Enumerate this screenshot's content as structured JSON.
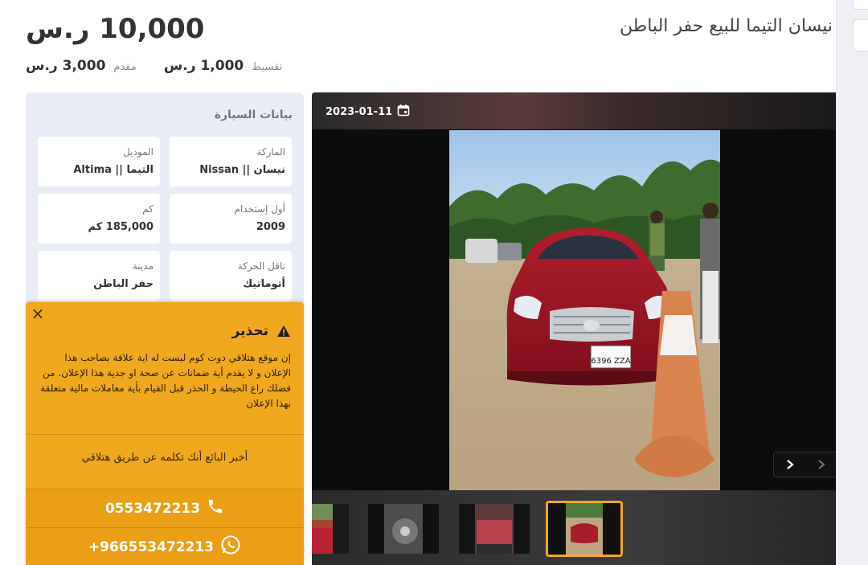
{
  "listing": {
    "title": "نيسان التيما للبيع حفر الباطن",
    "price": "10,000 ر.س"
  },
  "payments": {
    "installment_label": "تقسيط",
    "installment_value": "1,000 ر.س",
    "downpayment_label": "مقدم",
    "downpayment_value": "3,000 ر.س"
  },
  "details": {
    "title": "بيانات السيارة",
    "fields": [
      {
        "label": "الماركة",
        "value": "نيسان || Nissan"
      },
      {
        "label": "الموديل",
        "value": "التيما || Altima"
      },
      {
        "label": "أول إستخدام",
        "value": "2009"
      },
      {
        "label": "كم",
        "value": "185,000 كم"
      },
      {
        "label": "ناقل الحركة",
        "value": "أتوماتيك"
      },
      {
        "label": "مدينة",
        "value": "حفر الباطن"
      }
    ]
  },
  "warning": {
    "title": "تحذير",
    "body": "إن موقع هتلاقي دوت كوم ليست له اية علاقة بصاحب هذا الإعلان و لا يقدم أية ضمانات عن صحة او جدية هذا الإعلان. من فضلك راع الحيطة و الحذر قبل القيام بأية معاملات مالية متعلقة بهذا الإعلان",
    "hint": "أخبر البائع أنك تكلمه عن طريق هتلاقي",
    "phone": "0553472213",
    "whatsapp": "+966553472213",
    "close_icon": "close-icon",
    "icon": "warning-triangle-icon"
  },
  "gallery": {
    "date": "2023-01-11",
    "date_icon": "calendar-icon",
    "plate_text": "6396 ZZA",
    "thumbnail_count": 4,
    "active_thumbnail": 4
  },
  "colors": {
    "accent": "#f0a81e",
    "accent_dark": "#ea9f17",
    "card_bg": "#e9eef6"
  }
}
